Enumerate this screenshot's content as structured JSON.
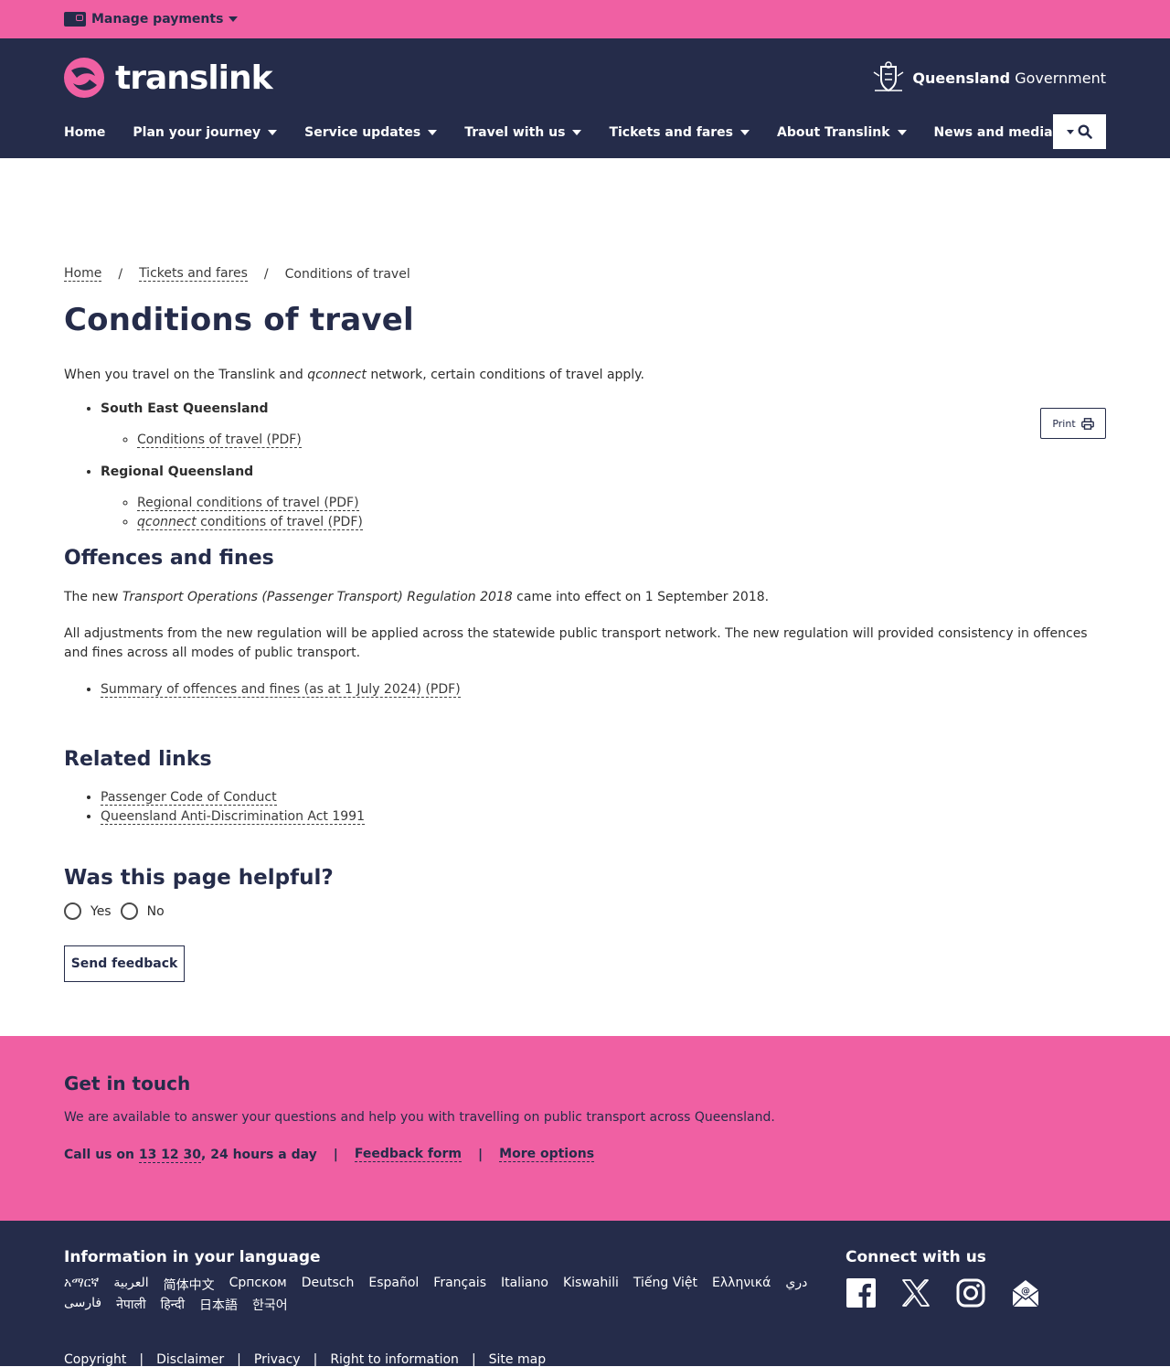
{
  "utility": {
    "manage_payments": "Manage payments"
  },
  "header": {
    "logo_text": "translink",
    "qgov_bold": "Queensland",
    "qgov_rest": " Government",
    "nav": [
      {
        "label": "Home"
      },
      {
        "label": "Plan your journey"
      },
      {
        "label": "Service updates"
      },
      {
        "label": "Travel with us"
      },
      {
        "label": "Tickets and fares"
      },
      {
        "label": "About Translink"
      },
      {
        "label": "News and media"
      }
    ]
  },
  "breadcrumb": {
    "home": "Home",
    "tickets": "Tickets and fares",
    "current": "Conditions of travel",
    "sep": "/"
  },
  "page": {
    "title": "Conditions of travel",
    "print": "Print",
    "intro_a": "When you travel on the Translink and ",
    "intro_em": "qconnect",
    "intro_b": " network, certain conditions of travel apply.",
    "seq": "South East Queensland",
    "seq_link": "Conditions of travel (PDF)",
    "regional": "Regional Queensland",
    "regional_link1": "Regional conditions of travel (PDF)",
    "regional_link2_em": "qconnect",
    "regional_link2_rest": " conditions of travel (PDF)"
  },
  "offences": {
    "heading": "Offences and fines",
    "p1_a": "The new ",
    "p1_em": "Transport Operations (Passenger Transport) Regulation 2018",
    "p1_b": " came into effect on 1 September 2018.",
    "p2": "All adjustments from the new regulation will be applied across the statewide public transport network. The new regulation will provided consistency in offences and fines across all modes of public transport.",
    "link": "Summary of offences and fines (as at 1 July 2024) (PDF)"
  },
  "related": {
    "heading": "Related links",
    "links": [
      "Passenger Code of Conduct",
      "Queensland Anti-Discrimination Act 1991"
    ]
  },
  "feedback": {
    "heading": "Was this page helpful?",
    "yes": "Yes",
    "no": "No",
    "button": "Send feedback"
  },
  "touch": {
    "heading": "Get in touch",
    "text": "We are available to answer your questions and help you with travelling on public transport across Queensland.",
    "call_prefix": "Call us on ",
    "phone": "13 12 30",
    "call_suffix": ", 24 hours a day",
    "sep": "|",
    "feedback_form": "Feedback form",
    "more_options": "More options"
  },
  "footer": {
    "lang_heading": "Information in your language",
    "languages": [
      "አማርኛ",
      "العربية",
      "简体中文",
      "Српском",
      "Deutsch",
      "Español",
      "Français",
      "Italiano",
      "Kiswahili",
      "Tiếng Việt",
      "Ελληνικά",
      "دري",
      "فارسی",
      "नेपाली",
      "हिन्दी",
      "日本語",
      "한국어"
    ],
    "connect_heading": "Connect with us",
    "legal": [
      "Copyright",
      "|",
      "Disclaimer",
      "|",
      "Privacy",
      "|",
      "Right to information",
      "|",
      "Site map"
    ]
  },
  "colors": {
    "pink": "#f060a3",
    "navy": "#252c4a"
  },
  "icons": [
    "card-icon",
    "caret-down-icon",
    "search-icon",
    "print-icon",
    "facebook-icon",
    "x-icon",
    "instagram-icon",
    "email-icon"
  ]
}
